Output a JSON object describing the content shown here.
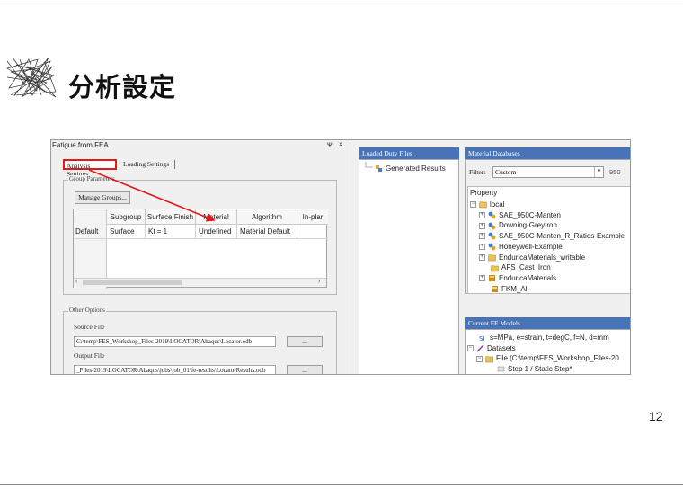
{
  "slide": {
    "title": "分析設定",
    "page_number": "12"
  },
  "left_panel": {
    "window_title": "Fatigue from FEA",
    "pin_glyph": "ᴪ",
    "close_glyph": "×",
    "tabs": [
      {
        "label": "Analysis Settings",
        "active": true
      },
      {
        "label": "Loading Settings",
        "active": false
      }
    ],
    "group_parameters": {
      "legend": "Group Parameters",
      "manage_button": "Manage Groups...",
      "columns": [
        "Subgroup",
        "Surface Finish",
        "Material",
        "Algorithm",
        "In-plar"
      ],
      "rows": [
        {
          "label": "Default",
          "cells": [
            "Surface",
            "Kt = 1",
            "Undefined",
            "Material Default",
            ""
          ]
        }
      ]
    },
    "other_options": {
      "legend": "Other Options",
      "source_file_label": "Source File",
      "source_file_value": "C:\\temp\\FES_Workshop_Files-2019\\LOCATOR\\Abaqus\\Locator.odb",
      "output_file_label": "Output File",
      "output_file_value": "_Files-2019\\LOCATOR\\Abaqus\\jobs\\job_01\\fe-results\\LocatorResults.odb",
      "browse_label": "..."
    }
  },
  "loaded_duty_files": {
    "title": "Loaded Duty Files",
    "items": [
      {
        "label": "Generated Results"
      }
    ]
  },
  "material_databases": {
    "title": "Material Databases",
    "filter_label": "Filter:",
    "filter_value": "Custom",
    "filter_number": "950",
    "property_header": "Property",
    "items": [
      {
        "label": "local",
        "exp": "−",
        "icon": "folder-icon"
      },
      {
        "label": "SAE_950C-Manten",
        "exp": "+",
        "icon": "material-icon"
      },
      {
        "label": "Downing-GreyIron",
        "exp": "+",
        "icon": "material-icon"
      },
      {
        "label": "SAE_950C-Manten_R_Ratios-Example",
        "exp": "+",
        "icon": "material-icon"
      },
      {
        "label": "Honeywell-Example",
        "exp": "+",
        "icon": "material-icon"
      },
      {
        "label": "EnduricaMaterials_writable",
        "exp": "+",
        "icon": "folder-icon"
      },
      {
        "label": "AFS_Cast_Iron",
        "exp": "",
        "icon": "folder-icon"
      },
      {
        "label": "EnduricaMaterials",
        "exp": "+",
        "icon": "database-icon"
      },
      {
        "label": "FKM_Al",
        "exp": "",
        "icon": "database-icon"
      }
    ]
  },
  "current_fe_models": {
    "title": "Current FE Models",
    "items": [
      {
        "label": "s=MPa, e=strain, t=degC, f=N, d=mm",
        "exp": "",
        "icon": "units-icon"
      },
      {
        "label": "Datasets",
        "exp": "−",
        "icon": "datasets-icon"
      },
      {
        "label": "File (C:\\temp\\FES_Workshop_Files-20",
        "exp": "−",
        "icon": "folder-icon"
      },
      {
        "label": "Step 1 / Static Step*",
        "exp": "",
        "icon": "step-icon"
      }
    ]
  },
  "colors": {
    "highlight": "#e01818",
    "panel_title_bg": "#4873b6"
  }
}
